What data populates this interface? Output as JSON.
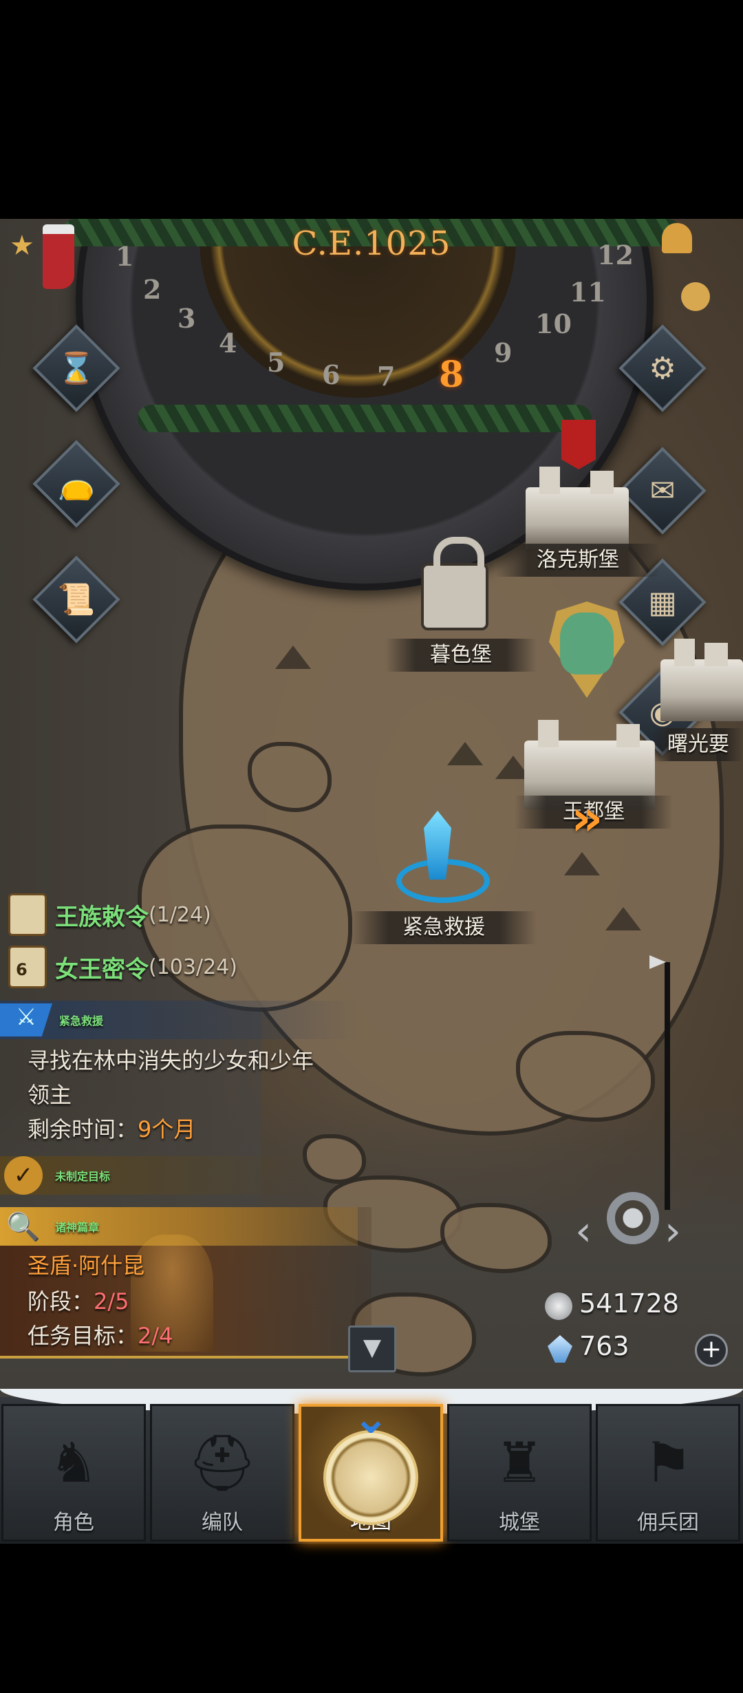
{
  "calendar": {
    "era_label": "C.E.1025",
    "months": [
      "1",
      "2",
      "3",
      "4",
      "5",
      "6",
      "7",
      "8",
      "9",
      "10",
      "11",
      "12"
    ],
    "current_month": "8"
  },
  "locations": {
    "lokes": "洛克斯堡",
    "dusk": "暮色堡",
    "dawn": "曙光要",
    "king": "王都堡",
    "rescue": "紧急救援"
  },
  "quests": {
    "royal_edict": {
      "label": "王族敕令",
      "count": "(1/24)"
    },
    "queen_order": {
      "label": "女王密令",
      "count": "(103/24)",
      "badge": "6"
    },
    "active": {
      "title": "紧急救援",
      "desc": "寻找在林中消失的少女和少年",
      "issuer": "领主",
      "time_label": "剩余时间：",
      "time_value": "9个月"
    },
    "goal": {
      "title": "未制定目标"
    },
    "chapter": {
      "title": "诸神篇章",
      "hero": "圣盾·阿什昆",
      "stage_label": "阶段：",
      "stage_value": "2/5",
      "target_label": "任务目标：",
      "target_value": "2/4"
    }
  },
  "resources": {
    "silver": "541728",
    "crystal": "763"
  },
  "nav": {
    "tabs": [
      "角色",
      "编队",
      "地图",
      "城堡",
      "佣兵团"
    ],
    "active": "地图"
  },
  "icons": {
    "side_left": [
      "hourglass-icon",
      "bag-icon",
      "scroll-icon"
    ],
    "side_right": [
      "gear-icon",
      "mail-icon",
      "castle-gate-icon",
      "coin-icon"
    ]
  },
  "colors": {
    "accent": "#f0a030",
    "quest_green": "#7ce07a",
    "highlight_orange": "#ffa03a",
    "progress_pink": "#ff6f72"
  }
}
